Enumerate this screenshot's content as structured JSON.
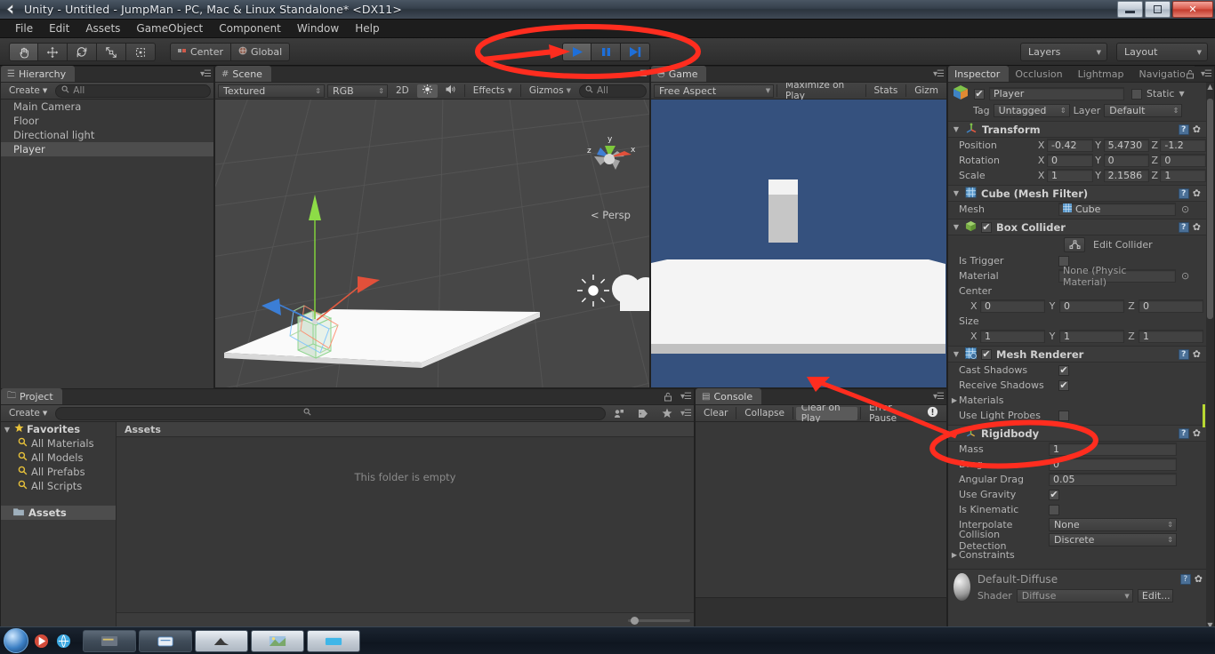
{
  "window": {
    "title": "Unity - Untitled - JumpMan - PC, Mac & Linux Standalone* <DX11>",
    "app_icon": "unity-icon",
    "minimize_label": "Minimize",
    "restore_label": "Restore",
    "close_label": "Close"
  },
  "menubar": {
    "items": [
      {
        "label": "File"
      },
      {
        "label": "Edit"
      },
      {
        "label": "Assets"
      },
      {
        "label": "GameObject"
      },
      {
        "label": "Component"
      },
      {
        "label": "Window"
      },
      {
        "label": "Help"
      }
    ]
  },
  "toolbar": {
    "transform_tools": [
      {
        "name": "hand-tool",
        "icon": "hand-icon",
        "active": true
      },
      {
        "name": "move-tool",
        "icon": "move-arrows-icon",
        "active": false
      },
      {
        "name": "rotate-tool",
        "icon": "rotate-icon",
        "active": false
      },
      {
        "name": "scale-tool",
        "icon": "scale-icon",
        "active": false
      },
      {
        "name": "rect-tool",
        "icon": "rect-transform-icon",
        "active": false
      }
    ],
    "pivot_label": "Center",
    "pivot_icon": "pivot-center-icon",
    "space_label": "Global",
    "space_icon": "global-space-icon",
    "play_label": "Play",
    "pause_label": "Pause",
    "step_label": "Step",
    "play_state": "playing",
    "play_color": "#1e6fd9",
    "layers_label": "Layers",
    "layout_label": "Layout"
  },
  "hierarchy": {
    "tab_label": "Hierarchy",
    "tab_icon": "hierarchy-icon",
    "create_label": "Create",
    "search_placeholder": "All",
    "search_value": "",
    "items": [
      {
        "label": "Main Camera",
        "selected": false
      },
      {
        "label": "Floor",
        "selected": false
      },
      {
        "label": "Directional light",
        "selected": false
      },
      {
        "label": "Player",
        "selected": true
      }
    ]
  },
  "scene": {
    "tab_label": "Scene",
    "tab_icon": "scene-icon",
    "draw_mode": "Textured",
    "color_mode": "RGB",
    "mode_2d": "2D",
    "lighting_icon": "sun-icon",
    "audio_icon": "speaker-icon",
    "effects_label": "Effects",
    "gizmos_label": "Gizmos",
    "search_placeholder": "All",
    "gizmo_axis_x": "x",
    "gizmo_axis_y": "y",
    "gizmo_axis_z": "z",
    "persp_label": "Persp",
    "light_gizmo": "directional-light-gizmo",
    "camera_gizmo": "camera-gizmo"
  },
  "game": {
    "tab_label": "Game",
    "tab_icon": "game-icon",
    "aspect_label": "Free Aspect",
    "maximize_label": "Maximize on Play",
    "stats_label": "Stats",
    "gizmos_label": "Gizm",
    "sky_color": "#35517e",
    "floor_color": "#f4f4f4",
    "player_color": "#c6c6c6"
  },
  "project": {
    "tab_label": "Project",
    "tab_icon": "folder-icon",
    "create_label": "Create",
    "search_value": "",
    "favorites_label": "Favorites",
    "favorites": [
      {
        "label": "All Materials"
      },
      {
        "label": "All Models"
      },
      {
        "label": "All Prefabs"
      },
      {
        "label": "All Scripts"
      }
    ],
    "assets_label": "Assets",
    "breadcrumb": "Assets",
    "empty_message": "This folder is empty"
  },
  "console": {
    "tab_label": "Console",
    "tab_icon": "console-icon",
    "clear_label": "Clear",
    "collapse_label": "Collapse",
    "clear_on_play_label": "Clear on Play",
    "error_pause_label": "Error Pause",
    "error_icon": "error-badge-icon"
  },
  "inspector": {
    "tabs": [
      {
        "label": "Inspector",
        "selected": true
      },
      {
        "label": "Occlusion",
        "selected": false
      },
      {
        "label": "Lightmap",
        "selected": false
      },
      {
        "label": "Navigatio",
        "selected": false
      }
    ],
    "lock_icon": "lock-icon",
    "object_icon": "cube-icon",
    "object_enabled": true,
    "object_name": "Player",
    "static_label": "Static",
    "static_checked": false,
    "tag_label": "Tag",
    "tag_value": "Untagged",
    "layer_label": "Layer",
    "layer_value": "Default",
    "components": [
      {
        "name": "Transform",
        "icon": "transform-icon",
        "has_checkbox": false,
        "rows": [
          {
            "label": "Position",
            "vector": [
              {
                "axis": "X",
                "value": "-0.42"
              },
              {
                "axis": "Y",
                "value": "5.4730"
              },
              {
                "axis": "Z",
                "value": "-1.2"
              }
            ]
          },
          {
            "label": "Rotation",
            "vector": [
              {
                "axis": "X",
                "value": "0"
              },
              {
                "axis": "Y",
                "value": "0"
              },
              {
                "axis": "Z",
                "value": "0"
              }
            ]
          },
          {
            "label": "Scale",
            "vector": [
              {
                "axis": "X",
                "value": "1"
              },
              {
                "axis": "Y",
                "value": "2.1586"
              },
              {
                "axis": "Z",
                "value": "1"
              }
            ]
          }
        ]
      },
      {
        "name": "Cube (Mesh Filter)",
        "icon": "mesh-filter-icon",
        "has_checkbox": false,
        "mesh_label": "Mesh",
        "mesh_value": "Cube"
      },
      {
        "name": "Box Collider",
        "icon": "box-collider-icon",
        "has_checkbox": true,
        "checked": true,
        "edit_collider_label": "Edit Collider",
        "is_trigger_label": "Is Trigger",
        "is_trigger_checked": false,
        "material_label": "Material",
        "material_value": "None (Physic Material)",
        "center_label": "Center",
        "center": [
          {
            "axis": "X",
            "value": "0"
          },
          {
            "axis": "Y",
            "value": "0"
          },
          {
            "axis": "Z",
            "value": "0"
          }
        ],
        "size_label": "Size",
        "size": [
          {
            "axis": "X",
            "value": "1"
          },
          {
            "axis": "Y",
            "value": "1"
          },
          {
            "axis": "Z",
            "value": "1"
          }
        ]
      },
      {
        "name": "Mesh Renderer",
        "icon": "mesh-renderer-icon",
        "has_checkbox": true,
        "checked": true,
        "cast_shadows_label": "Cast Shadows",
        "cast_shadows_checked": true,
        "receive_shadows_label": "Receive Shadows",
        "receive_shadows_checked": true,
        "materials_label": "Materials",
        "use_light_probes_label": "Use Light Probes",
        "use_light_probes_checked": false
      },
      {
        "name": "Rigidbody",
        "icon": "rigidbody-icon",
        "has_checkbox": false,
        "mass_label": "Mass",
        "mass_value": "1",
        "drag_label": "Drag",
        "drag_value": "0",
        "angular_drag_label": "Angular Drag",
        "angular_drag_value": "0.05",
        "use_gravity_label": "Use Gravity",
        "use_gravity_checked": true,
        "is_kinematic_label": "Is Kinematic",
        "is_kinematic_checked": false,
        "interpolate_label": "Interpolate",
        "interpolate_value": "None",
        "collision_detection_label": "Collision Detection",
        "collision_detection_value": "Discrete",
        "constraints_label": "Constraints"
      }
    ],
    "material_preview": {
      "name": "Default-Diffuse",
      "shader_label": "Shader",
      "shader_value": "Diffuse",
      "edit_label": "Edit..."
    }
  },
  "annotations": {
    "color": "#ff2d1f",
    "ellipse_play_label": "highlight-play-buttons",
    "ellipse_rigidbody_label": "highlight-rigidbody-component",
    "arrow_top_label": "arrow-to-play-buttons",
    "arrow_bottom_label": "arrow-to-rigidbody"
  },
  "taskbar": {
    "start_label": "Start",
    "items": [
      {
        "name": "task-item-1"
      },
      {
        "name": "task-item-2"
      },
      {
        "name": "task-item-3"
      },
      {
        "name": "task-item-4"
      },
      {
        "name": "task-item-5"
      }
    ]
  }
}
